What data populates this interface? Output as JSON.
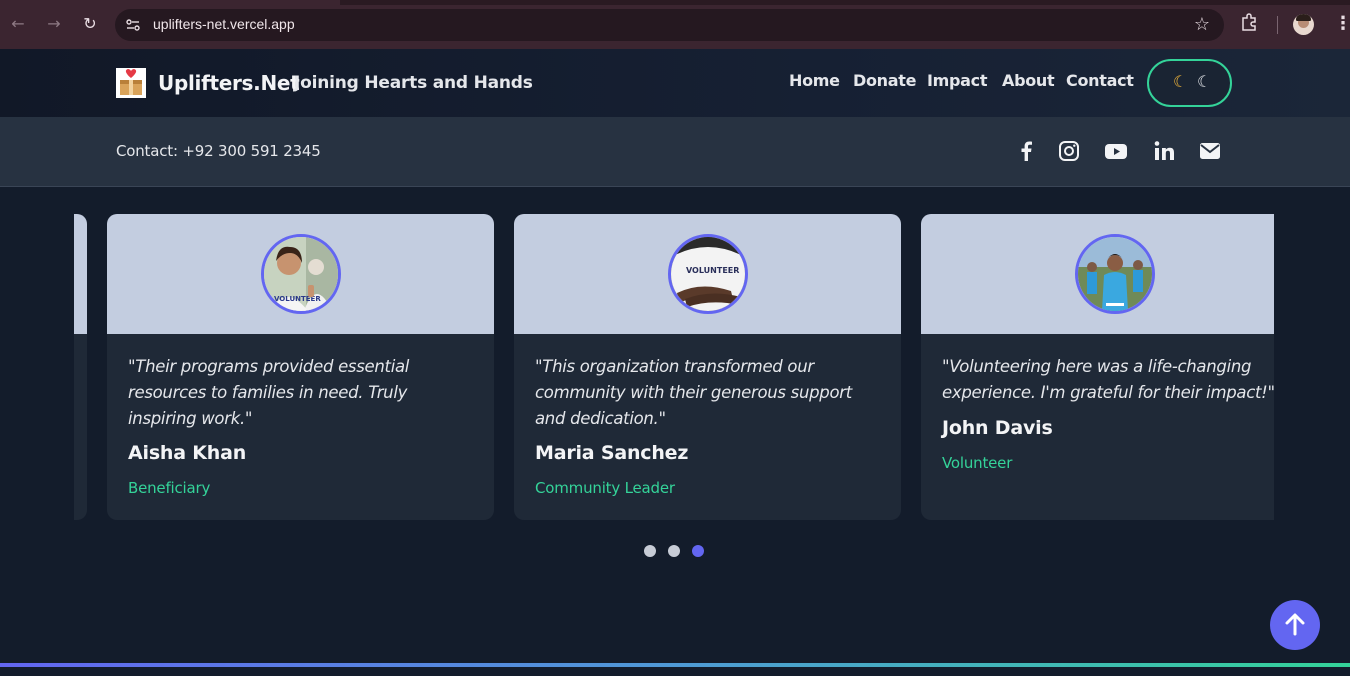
{
  "browser": {
    "url": "uplifters-net.vercel.app"
  },
  "header": {
    "brand": "Uplifters.Net",
    "tagline": "Joining Hearts and Hands",
    "nav": [
      "Home",
      "Donate",
      "Impact",
      "About",
      "Contact"
    ],
    "theme_toggle_icons": [
      "moon-yellow-icon",
      "moon-outline-icon"
    ]
  },
  "contact_bar": {
    "text": "Contact: +92 300 591 2345",
    "social_icons": [
      "facebook-icon",
      "instagram-icon",
      "youtube-icon",
      "linkedin-icon",
      "email-icon"
    ]
  },
  "testimonials": [
    {
      "quote": "\"Their programs provided essential resources to families in need. Truly inspiring work.\"",
      "name": "Aisha Khan",
      "role": "Beneficiary"
    },
    {
      "quote": "\"This organization transformed our community with their generous support and dedication.\"",
      "name": "Maria Sanchez",
      "role": "Community Leader"
    },
    {
      "quote": "\"Volunteering here was a life-changing experience. I'm grateful for their impact!\"",
      "name": "John Davis",
      "role": "Volunteer"
    }
  ],
  "carousel": {
    "dots": 3,
    "active_dot": 3
  },
  "colors": {
    "accent": "#6366f1",
    "green": "#34d399",
    "background": "#131c2b"
  }
}
